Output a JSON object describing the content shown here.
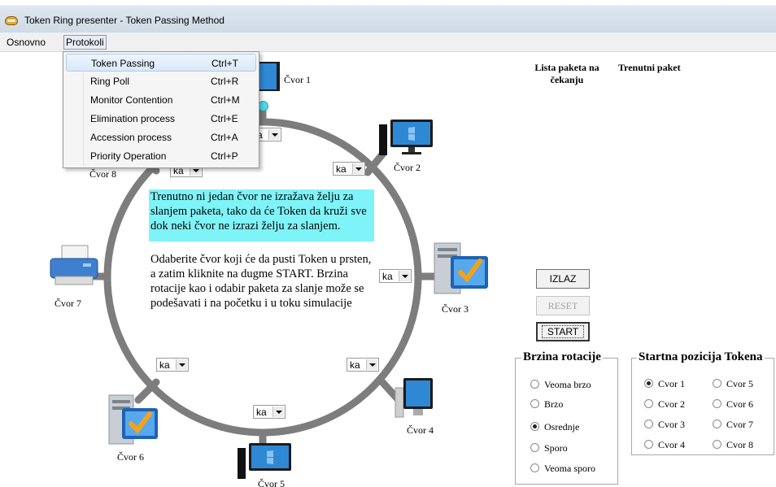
{
  "window": {
    "title": "Token Ring presenter - Token Passing Method"
  },
  "menubar": {
    "items": [
      "Osnovno",
      "Protokoli"
    ]
  },
  "dropdown": {
    "items": [
      {
        "label": "Token Passing",
        "shortcut": "Ctrl+T"
      },
      {
        "label": "Ring Poll",
        "shortcut": "Ctrl+R"
      },
      {
        "label": "Monitor Contention",
        "shortcut": "Ctrl+M"
      },
      {
        "label": "Elimination process",
        "shortcut": "Ctrl+E"
      },
      {
        "label": "Accession process",
        "shortcut": "Ctrl+A"
      },
      {
        "label": "Priority Operation",
        "shortcut": "Ctrl+P"
      }
    ]
  },
  "nodes": {
    "n1": "Čvor 1",
    "n2": "Čvor 2",
    "n3": "Čvor 3",
    "n4": "Čvor 4",
    "n5": "Čvor 5",
    "n6": "Čvor 6",
    "n7": "Čvor 7",
    "n8": "Čvor 8"
  },
  "combos": {
    "value": "ka"
  },
  "info": {
    "highlight": "Trenutno ni jedan čvor ne izražava želju za slanjem paketa, tako da će Token da kruži sve dok neki čvor ne izrazi želju za slanjem.",
    "instructions": "Odaberite čvor koji će da pusti Token u prsten,  a zatim kliknite na dugme START. Brzina rotacije kao i odabir paketa za slanje može se podešavati i na početku i u toku simulacije"
  },
  "panels": {
    "queue_header": "Lista paketa na čekanju",
    "current_header": "Trenutni paket"
  },
  "buttons": {
    "exit": "IZLAZ",
    "reset": "RESET",
    "start": "START"
  },
  "speed": {
    "title": "Brzina rotacije",
    "options": [
      "Veoma brzo",
      "Brzo",
      "Osrednje",
      "Sporo",
      "Veoma sporo"
    ],
    "selected": "Osrednje"
  },
  "start_position": {
    "title": "Startna pozicija Tokena",
    "options": [
      "Cvor 1",
      "Cvor 2",
      "Cvor 3",
      "Cvor 4",
      "Cvor 5",
      "Cvor 6",
      "Cvor 7",
      "Cvor 8"
    ],
    "selected": "Cvor 1"
  },
  "colors": {
    "ring": "#7d7d7d",
    "highlight": "#7ff4f8",
    "token": "#4fd9e9",
    "screen": "#2f88d4"
  }
}
